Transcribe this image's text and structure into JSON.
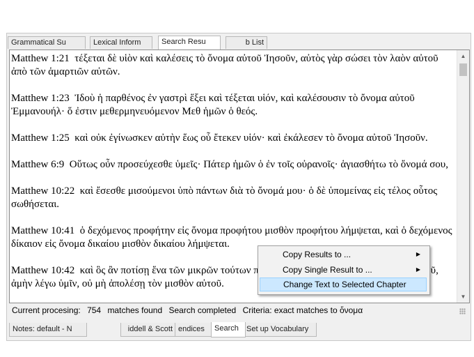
{
  "top_tabs": [
    {
      "label": "Grammatical Su"
    },
    {
      "label": "Lexical Inform"
    },
    {
      "label": "Search Resu"
    },
    {
      "label": "b List"
    }
  ],
  "results": [
    {
      "ref": "Matthew 1:21",
      "text": "τέξεται δὲ υἱὸν καὶ καλέσεις τὸ ὄνομα αὐτοῦ Ἰησοῦν, αὐτὸς γὰρ σώσει τὸν λαὸν αὐτοῦ ἀπὸ τῶν ἁμαρτιῶν αὐτῶν."
    },
    {
      "ref": "Matthew 1:23",
      "text": "Ἰδοὺ ἡ παρθένος ἐν γαστρὶ ἕξει καὶ τέξεται υἱόν, καὶ καλέσουσιν τὸ ὄνομα αὐτοῦ Ἐμμανουήλ· ὅ ἐστιν μεθερμηνευόμενον Μεθ ἡμῶν ὁ θεός."
    },
    {
      "ref": "Matthew 1:25",
      "text": "καὶ οὐκ ἐγίνωσκεν αὐτὴν ἕως οὗ ἔτεκεν υἱόν· καὶ ἐκάλεσεν τὸ ὄνομα αὐτοῦ Ἰησοῦν."
    },
    {
      "ref": "Matthew 6:9",
      "text": "Οὕτως οὖν προσεύχεσθε ὑμεῖς· Πάτερ ἡμῶν ὁ ἐν τοῖς οὐρανοῖς· ἁγιασθήτω τὸ ὄνομά σου,"
    },
    {
      "ref": "Matthew 10:22",
      "text": "καὶ ἔσεσθε μισούμενοι ὑπὸ πάντων διὰ τὸ ὄνομά μου· ὁ δὲ ὑπομείνας εἰς τέλος οὗτος σωθήσεται."
    },
    {
      "ref": "Matthew 10:41",
      "text": "ὁ δεχόμενος προφήτην εἰς ὄνομα προφήτου μισθὸν προφήτου λήμψεται, καὶ ὁ δεχόμενος δίκαιον εἰς ὄνομα δικαίου μισθὸν δικαίου λήμψεται."
    },
    {
      "ref": "Matthew 10:42",
      "text": "καὶ ὃς ἂν ποτίσῃ ἕνα τῶν μικρῶν τούτων ποτήριον ψυχροῦ μόνον εἰς ὄνομα μαθητοῦ, ἀμὴν λέγω ὑμῖν, οὐ μὴ ἀπολέσῃ τὸν μισθὸν αὐτοῦ."
    }
  ],
  "status": {
    "label": "Current procesing:",
    "count": "754",
    "matches": "matches found",
    "state": "Search completed",
    "criteria": "Criteria: exact matches to ὄνομα"
  },
  "bottom_tabs": [
    {
      "label": "Notes: default - N"
    },
    {
      "label": "iddell & Scott"
    },
    {
      "label": "endices"
    },
    {
      "label": "Search"
    },
    {
      "label": "Set up Vocabulary"
    }
  ],
  "context_menu": [
    {
      "label": "Copy Results to ...",
      "submenu": "▶"
    },
    {
      "label": "Copy Single Result to ...",
      "submenu": "▶"
    },
    {
      "label": "Change Text to Selected Chapter",
      "submenu": ""
    }
  ],
  "colors": {
    "menu_highlight": "#cce8ff",
    "menu_highlight_border": "#99d1ff"
  }
}
